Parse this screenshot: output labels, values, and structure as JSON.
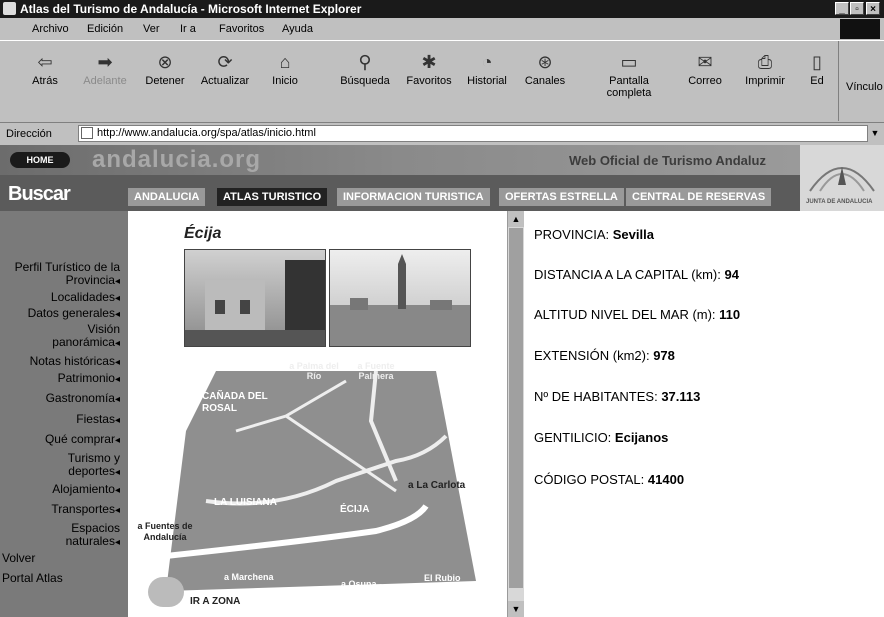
{
  "window": {
    "title": "Atlas del Turismo de Andalucía - Microsoft Internet Explorer"
  },
  "menu": [
    "Archivo",
    "Edición",
    "Ver",
    "Ir a",
    "Favoritos",
    "Ayuda"
  ],
  "toolbar": [
    {
      "label": "Atrás",
      "icon": "back-icon"
    },
    {
      "label": "Adelante",
      "icon": "forward-icon"
    },
    {
      "label": "Detener",
      "icon": "stop-icon"
    },
    {
      "label": "Actualizar",
      "icon": "refresh-icon"
    },
    {
      "label": "Inicio",
      "icon": "home-icon"
    },
    {
      "label": "Búsqueda",
      "icon": "search-icon"
    },
    {
      "label": "Favoritos",
      "icon": "favorites-icon"
    },
    {
      "label": "Historial",
      "icon": "history-icon"
    },
    {
      "label": "Canales",
      "icon": "channels-icon"
    },
    {
      "label": "Pantalla completa",
      "icon": "fullscreen-icon"
    },
    {
      "label": "Correo",
      "icon": "mail-icon"
    },
    {
      "label": "Imprimir",
      "icon": "print-icon"
    },
    {
      "label": "Ed",
      "icon": "edit-icon"
    }
  ],
  "links_label": "Vínculo",
  "address": {
    "label": "Dirección",
    "url": "http://www.andalucia.org/spa/atlas/inicio.html"
  },
  "site": {
    "home": "HOME",
    "logo": "andalucia.org",
    "tagline": "Web Oficial de Turismo Andaluz",
    "buscar": "Buscar",
    "emblem_text": "JUNTA DE ANDALUCIA"
  },
  "nav_tabs": [
    "ANDALUCIA",
    "ATLAS TURISTICO",
    "INFORMACION TURISTICA",
    "OFERTAS ESTRELLA",
    "CENTRAL DE RESERVAS"
  ],
  "sidebar": {
    "items": [
      "Perfil Turístico de la Provincia",
      "Localidades",
      "Datos generales",
      "Visión panorámica",
      "Notas históricas",
      "Patrimonio",
      "Gastronomía",
      "Fiestas",
      "Qué comprar",
      "Turismo y deportes",
      "Alojamiento",
      "Transportes",
      "Espacios naturales"
    ],
    "volver": "Volver",
    "portal": "Portal Atlas"
  },
  "city": {
    "name": "Écija"
  },
  "map": {
    "labels": [
      "a Palma del Río",
      "a Fuente Palmera",
      "CAÑADA DEL ROSAL",
      "a La Carlota",
      "LA LUISIANA",
      "ÉCIJA",
      "a Fuentes de Andalucía",
      "a Marchena",
      "a Osuna",
      "El Rubio"
    ],
    "zone_button": "IR A ZONA"
  },
  "info": [
    {
      "label": "PROVINCIA:",
      "value": "Sevilla"
    },
    {
      "label": "DISTANCIA A LA CAPITAL (km):",
      "value": "94"
    },
    {
      "label": "ALTITUD NIVEL DEL MAR (m):",
      "value": "110"
    },
    {
      "label": "EXTENSIÓN (km2):",
      "value": "978"
    },
    {
      "label": "Nº DE HABITANTES:",
      "value": "37.113"
    },
    {
      "label": "GENTILICIO:",
      "value": "Ecijanos"
    },
    {
      "label": "CÓDIGO POSTAL:",
      "value": "41400"
    }
  ]
}
